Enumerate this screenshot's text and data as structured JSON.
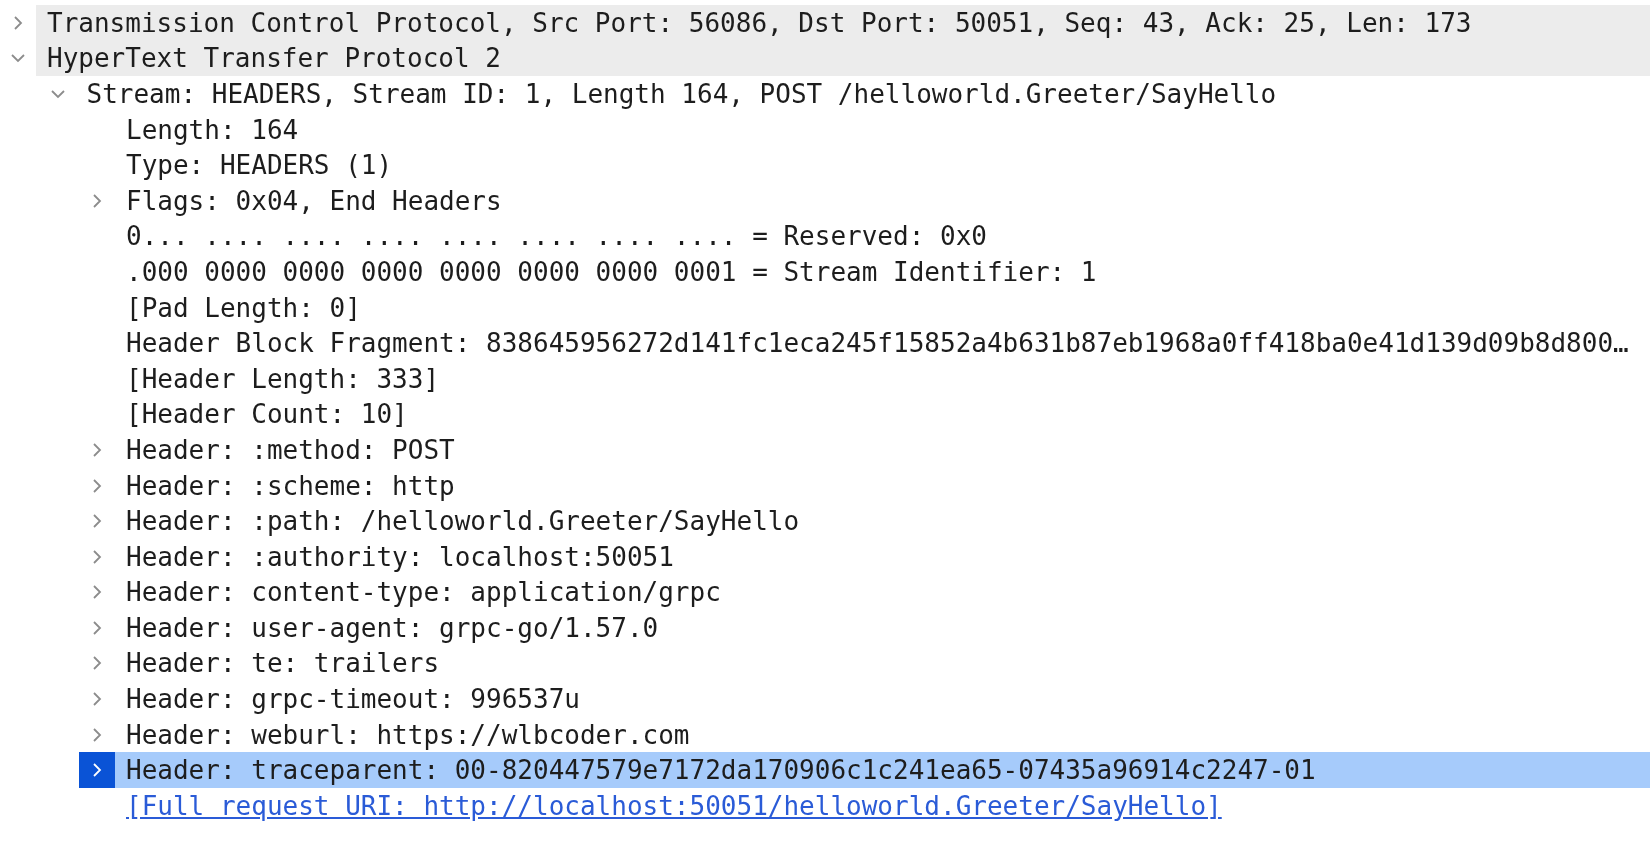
{
  "tree": [
    {
      "kind": "protocol",
      "label": "Transmission Control Protocol, Src Port: 56086, Dst Port: 50051, Seq: 43, Ack: 25, Len: 173",
      "expanded": false,
      "selected": false
    },
    {
      "kind": "protocol",
      "label": "HyperText Transfer Protocol 2",
      "expanded": true,
      "selected": false,
      "children": [
        {
          "kind": "field",
          "label": "Stream: HEADERS, Stream ID: 1, Length 164, POST /helloworld.Greeter/SayHello",
          "expanded": true,
          "selected": false,
          "children": [
            {
              "kind": "field",
              "label": "Length: 164",
              "selected": false
            },
            {
              "kind": "field",
              "label": "Type: HEADERS (1)",
              "selected": false
            },
            {
              "kind": "field",
              "label": "Flags: 0x04, End Headers",
              "expanded": false,
              "selected": false
            },
            {
              "kind": "field",
              "label": "0... .... .... .... .... .... .... .... = Reserved: 0x0",
              "selected": false
            },
            {
              "kind": "field",
              "label": ".000 0000 0000 0000 0000 0000 0000 0001 = Stream Identifier: 1",
              "selected": false
            },
            {
              "kind": "field",
              "label": "[Pad Length: 0]",
              "selected": false
            },
            {
              "kind": "field",
              "label": "Header Block Fragment: 838645956272d141fc1eca245f15852a4b631b87eb1968a0ff418ba0e41d139d09b8d800…",
              "selected": false
            },
            {
              "kind": "field",
              "label": "[Header Length: 333]",
              "selected": false
            },
            {
              "kind": "field",
              "label": "[Header Count: 10]",
              "selected": false
            },
            {
              "kind": "field",
              "label": "Header: :method: POST",
              "expanded": false,
              "selected": false
            },
            {
              "kind": "field",
              "label": "Header: :scheme: http",
              "expanded": false,
              "selected": false
            },
            {
              "kind": "field",
              "label": "Header: :path: /helloworld.Greeter/SayHello",
              "expanded": false,
              "selected": false
            },
            {
              "kind": "field",
              "label": "Header: :authority: localhost:50051",
              "expanded": false,
              "selected": false
            },
            {
              "kind": "field",
              "label": "Header: content-type: application/grpc",
              "expanded": false,
              "selected": false
            },
            {
              "kind": "field",
              "label": "Header: user-agent: grpc-go/1.57.0",
              "expanded": false,
              "selected": false
            },
            {
              "kind": "field",
              "label": "Header: te: trailers",
              "expanded": false,
              "selected": false
            },
            {
              "kind": "field",
              "label": "Header: grpc-timeout: 996537u",
              "expanded": false,
              "selected": false
            },
            {
              "kind": "field",
              "label": "Header: weburl: https://wlbcoder.com",
              "expanded": false,
              "selected": false
            },
            {
              "kind": "field",
              "label": "Header: traceparent: 00-820447579e7172da170906c1c241ea65-07435a96914c2247-01",
              "expanded": false,
              "selected": true
            },
            {
              "kind": "link",
              "label": "[Full request URI: http://localhost:50051/helloworld.Greeter/SayHello]",
              "selected": false
            }
          ]
        }
      ]
    }
  ]
}
